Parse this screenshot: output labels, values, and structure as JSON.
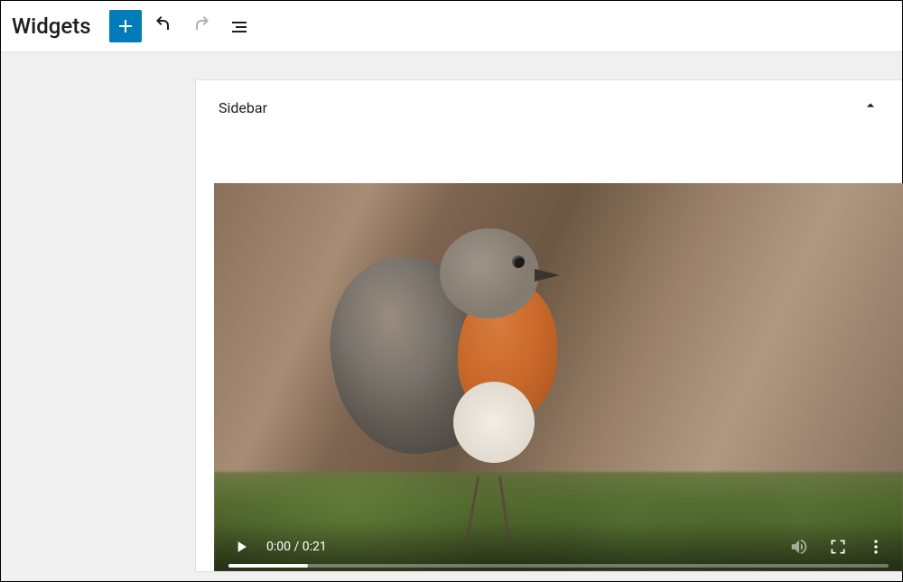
{
  "toolbar": {
    "page_title": "Widgets"
  },
  "panel": {
    "title": "Sidebar"
  },
  "video": {
    "current_time": "0:00",
    "duration": "0:21",
    "time_display": "0:00 / 0:21"
  }
}
